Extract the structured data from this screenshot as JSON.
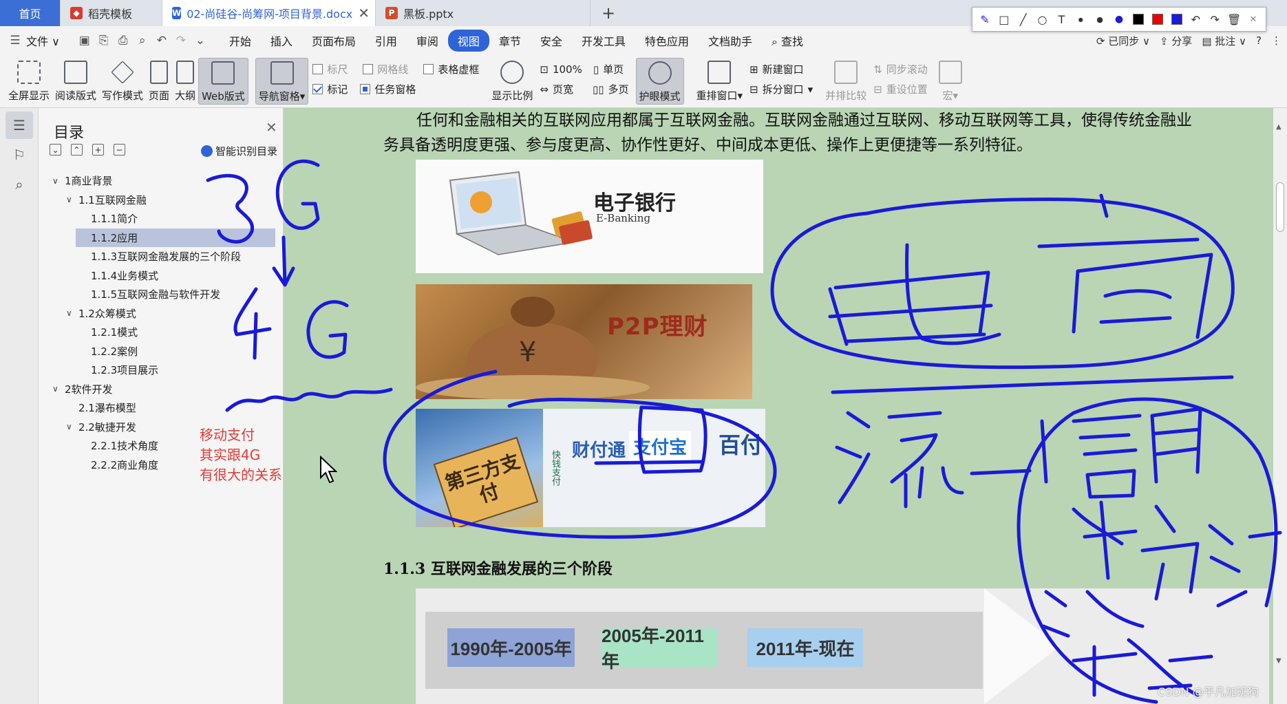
{
  "tabs": {
    "home": "首页",
    "template": "稻壳模板",
    "docx": "02-尚硅谷-尚筹网-项目背景.docx",
    "pptx": "黑板.pptx",
    "new": "+"
  },
  "menu": {
    "file": "文件",
    "items": [
      "开始",
      "插入",
      "页面布局",
      "引用",
      "审阅",
      "视图",
      "章节",
      "安全",
      "开发工具",
      "特色应用",
      "文档助手"
    ],
    "active": "视图",
    "search": "查找",
    "right": {
      "sync": "已同步",
      "share": "分享",
      "comment": "批注"
    }
  },
  "ribbon": {
    "fullscreen": "全屏显示",
    "reading": "阅读版式",
    "writing": "写作模式",
    "page": "页面",
    "outline": "大纲",
    "web": "Web版式",
    "nav_pane": "导航窗格",
    "ruler": "标尺",
    "gridlines": "网格线",
    "table_grid": "表格虚框",
    "marks": "标记",
    "task_pane": "任务窗格",
    "zoom": "显示比例",
    "zoom100": "100%",
    "single_page": "单页",
    "page_width": "页宽",
    "multi_page": "多页",
    "eye_care": "护眼模式",
    "rearrange": "重排窗口",
    "new_window": "新建窗口",
    "split_window": "拆分窗口",
    "side_by_side": "并排比较",
    "sync_scroll": "同步滚动",
    "reset_position": "重设位置",
    "macro": "宏"
  },
  "toc": {
    "title": "目录",
    "smart": "智能识别目录",
    "items": [
      {
        "label": "1商业背景",
        "level": 1,
        "arrow": "v"
      },
      {
        "label": "1.1互联网金融",
        "level": 2,
        "arrow": "v"
      },
      {
        "label": "1.1.1简介",
        "level": 3
      },
      {
        "label": "1.1.2应用",
        "level": 3,
        "selected": true
      },
      {
        "label": "1.1.3互联网金融发展的三个阶段",
        "level": 3
      },
      {
        "label": "1.1.4业务模式",
        "level": 3
      },
      {
        "label": "1.1.5互联网金融与软件开发",
        "level": 3
      },
      {
        "label": "1.2众筹模式",
        "level": 2,
        "arrow": "v"
      },
      {
        "label": "1.2.1模式",
        "level": 3
      },
      {
        "label": "1.2.2案例",
        "level": 3
      },
      {
        "label": "1.2.3项目展示",
        "level": 3
      },
      {
        "label": "2软件开发",
        "level": 1,
        "arrow": "v"
      },
      {
        "label": "2.1瀑布模型",
        "level": 2
      },
      {
        "label": "2.2敏捷开发",
        "level": 2,
        "arrow": "v"
      },
      {
        "label": "2.2.1技术角度",
        "level": 3
      },
      {
        "label": "2.2.2商业角度",
        "level": 3
      }
    ]
  },
  "doc": {
    "para_line1": "任何和金融相关的互联网应用都属于互联网金融。互联网金融通过互联网、移动互联网等工具，使得传统金融业",
    "para_line2": "务具备透明度更强、参与度更高、协作性更好、中间成本更低、操作上更便捷等一系列特征。",
    "ebank_cn": "电子银行",
    "ebank_en": "E-Banking",
    "p2p": "P2P理财",
    "third_party": "第三方支付",
    "pay1": "财付通",
    "pay2": "支付宝",
    "pay3": "百付",
    "pay4": "快钱支付",
    "heading": "1.1.3  互联网金融发展的三个阶段",
    "phases": [
      "1990年-2005年",
      "2005年-2011年",
      "2011年-现在"
    ]
  },
  "annotations": {
    "red_note": [
      "移动支付",
      "其实跟4G",
      "有很大的关系"
    ],
    "ink_text": [
      "3G",
      "4G",
      "电商",
      "流",
      "信息",
      "物流",
      "资金"
    ],
    "ink_color": "#1a1ad8"
  },
  "watermark": "CSDN @平凡加班狗",
  "colors": {
    "accent": "#2f63d8",
    "doc_bg": "#b9d5b4",
    "phase1": "#8ea3d6",
    "phase2": "#a9e4c6",
    "phase3": "#a7cfef",
    "red_note": "#e53935"
  }
}
